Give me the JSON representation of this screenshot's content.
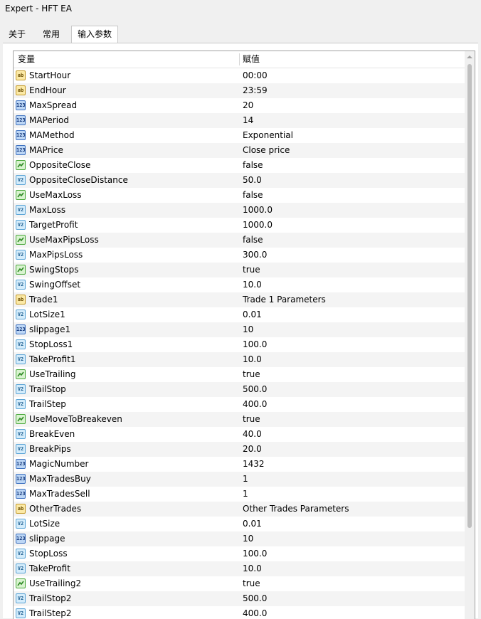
{
  "window": {
    "title": "Expert - HFT EA"
  },
  "tabs": [
    {
      "label": "关于"
    },
    {
      "label": "常用"
    },
    {
      "label": "输入参数"
    }
  ],
  "grid": {
    "columns": {
      "variable": "变量",
      "value": "赋值"
    },
    "rows": [
      {
        "icon": "ab",
        "name": "StartHour",
        "value": "00:00"
      },
      {
        "icon": "ab",
        "name": "EndHour",
        "value": "23:59"
      },
      {
        "icon": "123",
        "name": "MaxSpread",
        "value": "20"
      },
      {
        "icon": "123",
        "name": "MAPeriod",
        "value": "14"
      },
      {
        "icon": "123",
        "name": "MAMethod",
        "value": "Exponential"
      },
      {
        "icon": "123",
        "name": "MAPrice",
        "value": "Close price"
      },
      {
        "icon": "bool",
        "name": "OppositeClose",
        "value": "false"
      },
      {
        "icon": "v2",
        "name": "OppositeCloseDistance",
        "value": "50.0"
      },
      {
        "icon": "bool",
        "name": "UseMaxLoss",
        "value": "false"
      },
      {
        "icon": "v2",
        "name": "MaxLoss",
        "value": "1000.0"
      },
      {
        "icon": "v2",
        "name": "TargetProfit",
        "value": "1000.0"
      },
      {
        "icon": "bool",
        "name": "UseMaxPipsLoss",
        "value": "false"
      },
      {
        "icon": "v2",
        "name": "MaxPipsLoss",
        "value": "300.0"
      },
      {
        "icon": "bool",
        "name": "SwingStops",
        "value": "true"
      },
      {
        "icon": "v2",
        "name": "SwingOffset",
        "value": "10.0"
      },
      {
        "icon": "ab",
        "name": "Trade1",
        "value": "Trade 1 Parameters"
      },
      {
        "icon": "v2",
        "name": "LotSize1",
        "value": "0.01"
      },
      {
        "icon": "123",
        "name": "slippage1",
        "value": "10"
      },
      {
        "icon": "v2",
        "name": "StopLoss1",
        "value": "100.0"
      },
      {
        "icon": "v2",
        "name": "TakeProfit1",
        "value": "10.0"
      },
      {
        "icon": "bool",
        "name": "UseTrailing",
        "value": "true"
      },
      {
        "icon": "v2",
        "name": "TrailStop",
        "value": "500.0"
      },
      {
        "icon": "v2",
        "name": "TrailStep",
        "value": "400.0"
      },
      {
        "icon": "bool",
        "name": "UseMoveToBreakeven",
        "value": "true"
      },
      {
        "icon": "v2",
        "name": "BreakEven",
        "value": "40.0"
      },
      {
        "icon": "v2",
        "name": "BreakPips",
        "value": "20.0"
      },
      {
        "icon": "123",
        "name": "MagicNumber",
        "value": "1432"
      },
      {
        "icon": "123",
        "name": "MaxTradesBuy",
        "value": "1"
      },
      {
        "icon": "123",
        "name": "MaxTradesSell",
        "value": "1"
      },
      {
        "icon": "ab",
        "name": "OtherTrades",
        "value": "Other Trades Parameters"
      },
      {
        "icon": "v2",
        "name": "LotSize",
        "value": "0.01"
      },
      {
        "icon": "123",
        "name": "slippage",
        "value": "10"
      },
      {
        "icon": "v2",
        "name": "StopLoss",
        "value": "100.0"
      },
      {
        "icon": "v2",
        "name": "TakeProfit",
        "value": "10.0"
      },
      {
        "icon": "bool",
        "name": "UseTrailing2",
        "value": "true"
      },
      {
        "icon": "v2",
        "name": "TrailStop2",
        "value": "500.0"
      },
      {
        "icon": "v2",
        "name": "TrailStep2",
        "value": "400.0"
      }
    ]
  },
  "icon_glyphs": {
    "ab": "ab",
    "123": "123",
    "v2": "V2"
  },
  "colors": {
    "accent_blue": "#3f72c0",
    "bool_green": "#4aa83c",
    "string_gold": "#c49a2a"
  }
}
